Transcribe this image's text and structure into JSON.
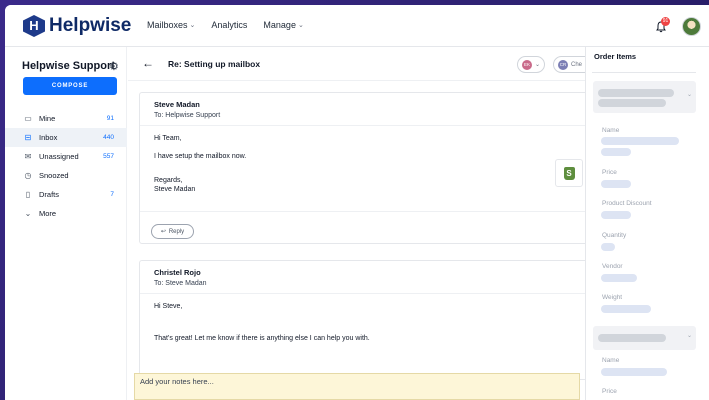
{
  "brand": {
    "name": "Helpwise"
  },
  "nav": {
    "items": [
      {
        "label": "Mailboxes",
        "has_caret": true
      },
      {
        "label": "Analytics",
        "has_caret": false
      },
      {
        "label": "Manage",
        "has_caret": true
      }
    ]
  },
  "header": {
    "notification_count": "91"
  },
  "sidebar": {
    "workspace": "Helpwise Support",
    "compose_label": "COMPOSE",
    "items": [
      {
        "label": "Mine",
        "count": "91",
        "icon": "monitor-icon"
      },
      {
        "label": "Inbox",
        "count": "440",
        "icon": "inbox-icon",
        "active": true
      },
      {
        "label": "Unassigned",
        "count": "557",
        "icon": "envelope-open-icon"
      },
      {
        "label": "Snoozed",
        "count": "",
        "icon": "clock-icon"
      },
      {
        "label": "Drafts",
        "count": "7",
        "icon": "file-icon"
      },
      {
        "label": "More",
        "count": "",
        "icon": "chevron-down-icon"
      }
    ]
  },
  "conversation": {
    "subject": "Re: Setting up mailbox",
    "assignee_initials": "EK",
    "collaborator_initials": "CR",
    "collaborator_label": "Che",
    "messages": [
      {
        "from": "Steve Madan",
        "to": "To: Helpwise Support",
        "body": [
          "Hi Team,",
          "I have setup the mailbox now.",
          "Regards,",
          "Steve Madan"
        ]
      },
      {
        "from": "Christel Rojo",
        "to": "To: Steve Madan",
        "body": [
          "Hi Steve,",
          "That's great! Let me know if there is anything else I can help you with."
        ]
      }
    ],
    "reply_label": "Reply",
    "notes_placeholder": "Add your notes here..."
  },
  "order_panel": {
    "title": "Order Items",
    "fields": [
      "Name",
      "Price",
      "Product Discount",
      "Quantity",
      "Vendor",
      "Weight",
      "Name",
      "Price"
    ]
  },
  "colors": {
    "accent": "#0d6efd",
    "brand": "#0f2a66",
    "notes_bg": "#fdf6d8",
    "shopify": "#5e8e3e"
  }
}
